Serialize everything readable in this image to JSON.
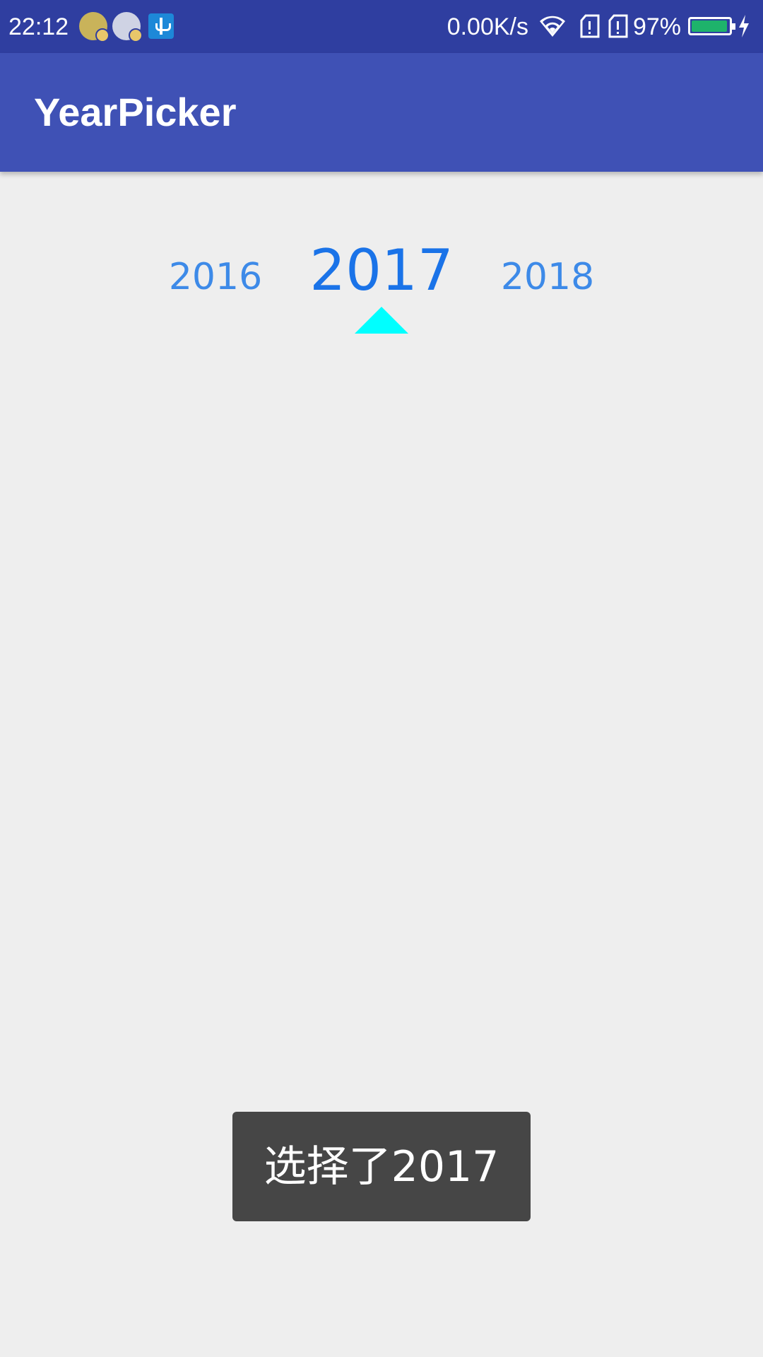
{
  "status_bar": {
    "time": "22:12",
    "network_speed": "0.00K/s",
    "battery_percent": "97%",
    "battery_level": 0.97,
    "icons": [
      "app-notification-icon",
      "app-notification-icon",
      "usb-icon",
      "wifi-icon",
      "sim-card-icon",
      "sim-card-icon",
      "battery-icon",
      "charging-icon"
    ]
  },
  "app_bar": {
    "title": "YearPicker"
  },
  "year_picker": {
    "previous_year": "2016",
    "selected_year": "2017",
    "next_year": "2018",
    "indicator_color": "#00ffff",
    "year_color": "#1a73e8"
  },
  "toast": {
    "message": "选择了2017"
  },
  "colors": {
    "status_bar": "#2f3ea0",
    "app_bar": "#3f51b5",
    "background": "#eeeeee",
    "toast": "#464646"
  }
}
